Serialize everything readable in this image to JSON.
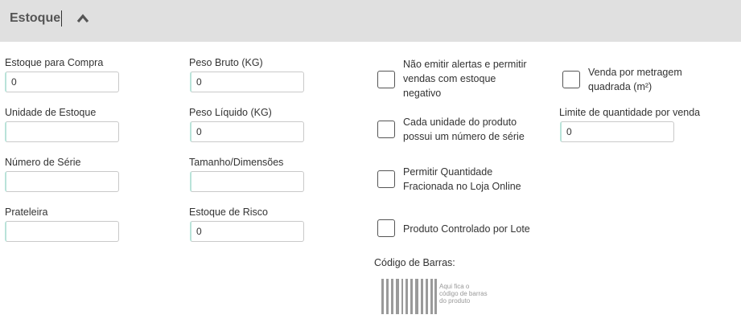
{
  "header": {
    "title": "Estoque",
    "toggle_icon": "chevron-up-icon"
  },
  "fields": {
    "estoque_compra": {
      "label": "Estoque para Compra",
      "value": "0"
    },
    "unidade_estoque": {
      "label": "Unidade de Estoque",
      "value": ""
    },
    "numero_serie": {
      "label": "Número de Série",
      "value": ""
    },
    "prateleira": {
      "label": "Prateleira",
      "value": ""
    },
    "peso_bruto": {
      "label": "Peso Bruto (KG)",
      "value": "0"
    },
    "peso_liquido": {
      "label": "Peso Líquido (KG)",
      "value": "0"
    },
    "tamanho": {
      "label": "Tamanho/Dimensões",
      "value": ""
    },
    "estoque_risco": {
      "label": "Estoque de Risco",
      "value": "0"
    },
    "limite_venda": {
      "label": "Limite de quantidade por venda",
      "value": "0"
    }
  },
  "checkboxes": {
    "nao_emitir": {
      "line1": "Não emitir alertas e permitir",
      "line2": "vendas com estoque",
      "line3": "negativo",
      "checked": false
    },
    "cada_unidade": {
      "line1": "Cada unidade do produto",
      "line2": "possui um número de série",
      "checked": false
    },
    "fracionada": {
      "line1": "Permitir Quantidade",
      "line2": "Fracionada no Loja Online",
      "checked": false
    },
    "lote": {
      "line1": "Produto Controlado por Lote",
      "checked": false
    },
    "metragem": {
      "line1": "Venda por metragem",
      "line2": "quadrada (m²)",
      "checked": false
    }
  },
  "barcode": {
    "label": "Código de Barras:",
    "caption_line1": "Aqui fica o",
    "caption_line2": "código de barras",
    "caption_line3": "do produto",
    "icon": "barcode-icon"
  },
  "colors": {
    "header_bg": "#e0e0e0",
    "input_accent": "#b9e3d9",
    "checkbox_border": "#555555"
  }
}
